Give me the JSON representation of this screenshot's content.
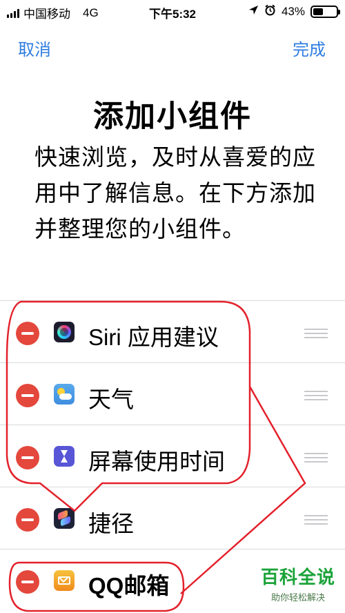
{
  "status_bar": {
    "carrier": "中国移动",
    "network": "4G",
    "time": "下午5:32",
    "battery": "43%",
    "battery_level": 0.43
  },
  "nav": {
    "cancel_label": "取消",
    "done_label": "完成"
  },
  "title": "添加小组件",
  "description": "快速浏览，及时从喜爱的应用中了解信息。在下方添加并整理您的小组件。",
  "widgets": [
    {
      "label": "Siri 应用建议",
      "icon": "siri-icon"
    },
    {
      "label": "天气",
      "icon": "weather-icon"
    },
    {
      "label": "屏幕使用时间",
      "icon": "screen-time-icon"
    },
    {
      "label": "捷径",
      "icon": "shortcuts-icon"
    },
    {
      "label": "QQ邮箱",
      "icon": "qq-mail-icon"
    }
  ],
  "watermark": {
    "main": "百科全说",
    "sub": "助你轻松解决"
  },
  "colors": {
    "accent": "#2f7de1",
    "remove": "#e4473c",
    "annotation": "#e3202a",
    "watermark": "#1ba339"
  }
}
